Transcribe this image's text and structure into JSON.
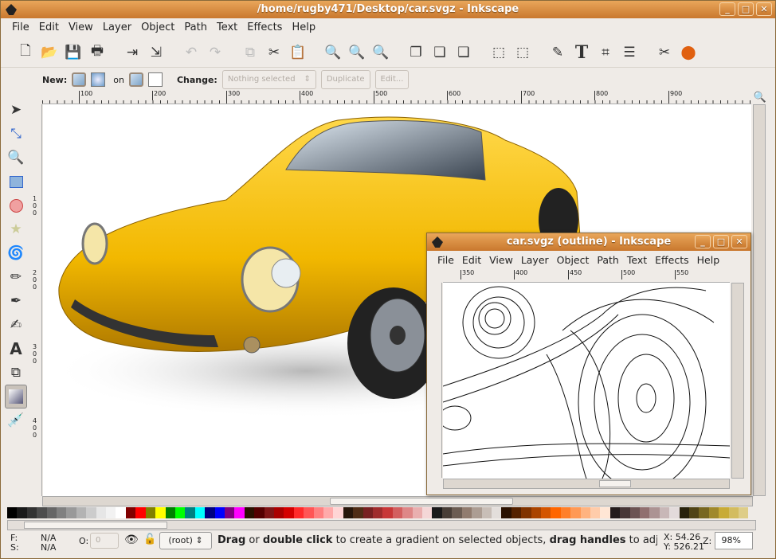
{
  "window": {
    "title": "/home/rugby471/Desktop/car.svgz - Inkscape",
    "controls": [
      "_",
      "□",
      "✕"
    ]
  },
  "menu": [
    "File",
    "Edit",
    "View",
    "Layer",
    "Object",
    "Path",
    "Text",
    "Effects",
    "Help"
  ],
  "tool_controls": {
    "new_label": "New:",
    "on_label": "on",
    "change_label": "Change:",
    "gradient_select": "Nothing selected",
    "duplicate": "Duplicate",
    "edit": "Edit..."
  },
  "ruler_h": [
    "100",
    "200",
    "300",
    "400",
    "500",
    "600",
    "700",
    "800",
    "900"
  ],
  "ruler_v": [
    "1",
    "0",
    "0",
    "2",
    "0",
    "0",
    "3",
    "0",
    "0",
    "4",
    "0",
    "0"
  ],
  "outline_window": {
    "title": "car.svgz (outline) - Inkscape",
    "ruler": [
      "350",
      "400",
      "450",
      "500",
      "550"
    ]
  },
  "palette": [
    "#000000",
    "#1a1a1a",
    "#333333",
    "#4d4d4d",
    "#666666",
    "#808080",
    "#999999",
    "#b3b3b3",
    "#cccccc",
    "#e6e6e6",
    "#f2f2f2",
    "#ffffff",
    "#800000",
    "#ff0000",
    "#808000",
    "#ffff00",
    "#008000",
    "#00ff00",
    "#008080",
    "#00ffff",
    "#000080",
    "#0000ff",
    "#800080",
    "#ff00ff",
    "#2b1100",
    "#550000",
    "#801515",
    "#aa0000",
    "#d40000",
    "#ff2a2a",
    "#ff5555",
    "#ff8080",
    "#ffaaaa",
    "#ffd5d5",
    "#28170b",
    "#502d16",
    "#782121",
    "#a02c2c",
    "#c83737",
    "#d35f5f",
    "#de8787",
    "#e9afaf",
    "#f4d7d7",
    "#1a1a1a",
    "#483e37",
    "#6c5d53",
    "#917c6f",
    "#ac9d93",
    "#c8beb7",
    "#e3dedb",
    "#2b1100",
    "#552200",
    "#803300",
    "#aa4400",
    "#d45500",
    "#ff6600",
    "#ff7f2a",
    "#ff9955",
    "#ffb380",
    "#ffccaa",
    "#ffe6d5",
    "#241c1c",
    "#483737",
    "#6c5353",
    "#916f6f",
    "#ac9393",
    "#c8b7b7",
    "#e3dbdb",
    "#28220b",
    "#504416",
    "#786721",
    "#a0892c",
    "#c8ab37",
    "#d3bc5f",
    "#decd87"
  ],
  "status": {
    "fill_label": "F:",
    "stroke_label": "S:",
    "fill_value": "N/A",
    "stroke_value": "N/A",
    "opacity_label": "O:",
    "opacity_value": "0",
    "layer": "(root)",
    "message_parts": [
      {
        "b": "Drag"
      },
      {
        "t": " or "
      },
      {
        "b": "double click"
      },
      {
        "t": " to create a gradient on selected objects, "
      },
      {
        "b": "drag handles"
      },
      {
        "t": " to adjust g"
      }
    ],
    "x": "X:  54.26",
    "y": "Y: 526.21",
    "zoom_label": "Z:",
    "zoom": "98%"
  }
}
